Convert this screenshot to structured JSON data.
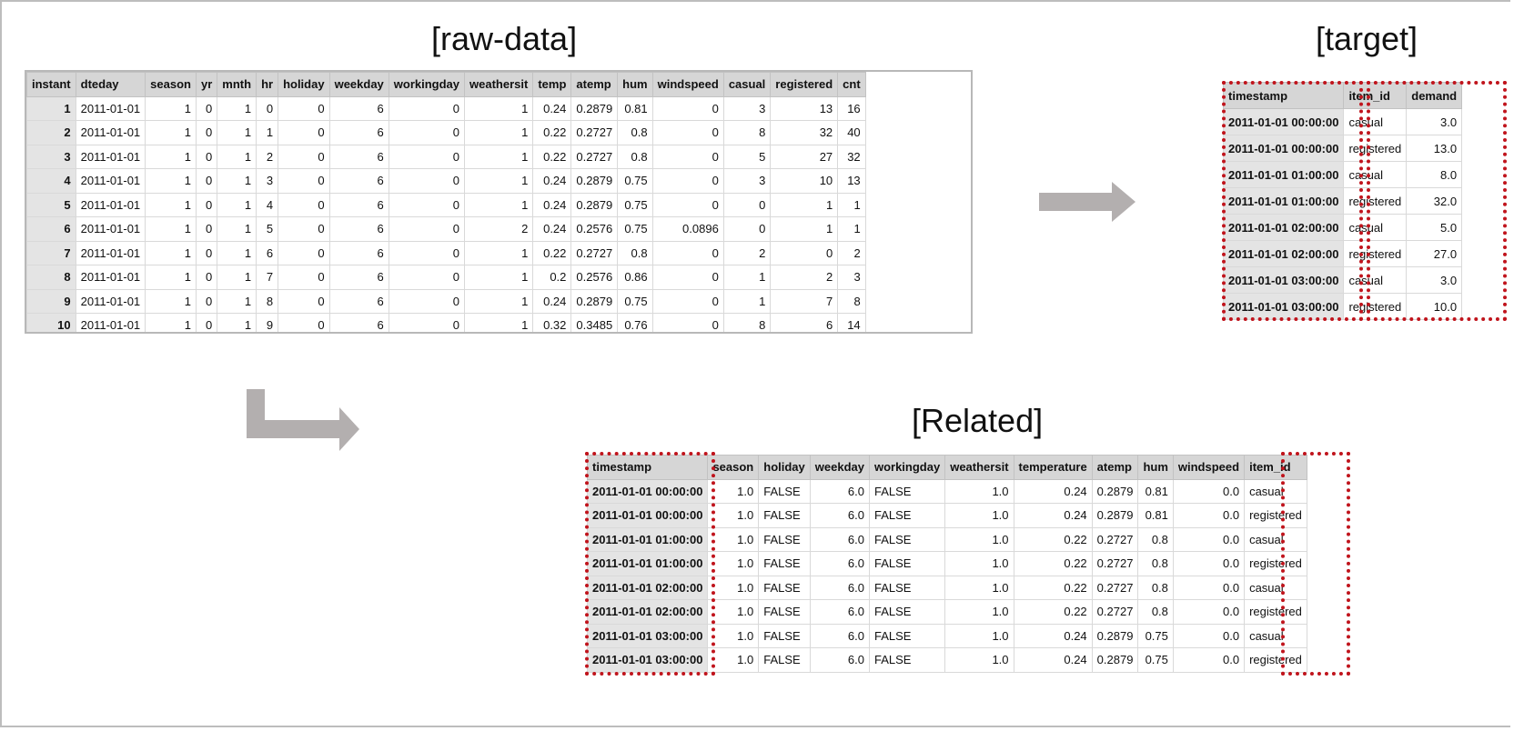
{
  "titles": {
    "raw": "[raw-data]",
    "target": "[target]",
    "related": "[Related]"
  },
  "raw_data": {
    "columns": [
      "instant",
      "dteday",
      "season",
      "yr",
      "mnth",
      "hr",
      "holiday",
      "weekday",
      "workingday",
      "weathersit",
      "temp",
      "atemp",
      "hum",
      "windspeed",
      "casual",
      "registered",
      "cnt"
    ],
    "rows": [
      [
        "1",
        "2011-01-01",
        "1",
        "0",
        "1",
        "0",
        "0",
        "6",
        "0",
        "1",
        "0.24",
        "0.2879",
        "0.81",
        "0",
        "3",
        "13",
        "16"
      ],
      [
        "2",
        "2011-01-01",
        "1",
        "0",
        "1",
        "1",
        "0",
        "6",
        "0",
        "1",
        "0.22",
        "0.2727",
        "0.8",
        "0",
        "8",
        "32",
        "40"
      ],
      [
        "3",
        "2011-01-01",
        "1",
        "0",
        "1",
        "2",
        "0",
        "6",
        "0",
        "1",
        "0.22",
        "0.2727",
        "0.8",
        "0",
        "5",
        "27",
        "32"
      ],
      [
        "4",
        "2011-01-01",
        "1",
        "0",
        "1",
        "3",
        "0",
        "6",
        "0",
        "1",
        "0.24",
        "0.2879",
        "0.75",
        "0",
        "3",
        "10",
        "13"
      ],
      [
        "5",
        "2011-01-01",
        "1",
        "0",
        "1",
        "4",
        "0",
        "6",
        "0",
        "1",
        "0.24",
        "0.2879",
        "0.75",
        "0",
        "0",
        "1",
        "1"
      ],
      [
        "6",
        "2011-01-01",
        "1",
        "0",
        "1",
        "5",
        "0",
        "6",
        "0",
        "2",
        "0.24",
        "0.2576",
        "0.75",
        "0.0896",
        "0",
        "1",
        "1"
      ],
      [
        "7",
        "2011-01-01",
        "1",
        "0",
        "1",
        "6",
        "0",
        "6",
        "0",
        "1",
        "0.22",
        "0.2727",
        "0.8",
        "0",
        "2",
        "0",
        "2"
      ],
      [
        "8",
        "2011-01-01",
        "1",
        "0",
        "1",
        "7",
        "0",
        "6",
        "0",
        "1",
        "0.2",
        "0.2576",
        "0.86",
        "0",
        "1",
        "2",
        "3"
      ],
      [
        "9",
        "2011-01-01",
        "1",
        "0",
        "1",
        "8",
        "0",
        "6",
        "0",
        "1",
        "0.24",
        "0.2879",
        "0.75",
        "0",
        "1",
        "7",
        "8"
      ],
      [
        "10",
        "2011-01-01",
        "1",
        "0",
        "1",
        "9",
        "0",
        "6",
        "0",
        "1",
        "0.32",
        "0.3485",
        "0.76",
        "0",
        "8",
        "6",
        "14"
      ]
    ]
  },
  "target": {
    "columns": [
      "timestamp",
      "item_id",
      "demand"
    ],
    "rows": [
      [
        "2011-01-01 00:00:00",
        "casual",
        "3.0"
      ],
      [
        "2011-01-01 00:00:00",
        "registered",
        "13.0"
      ],
      [
        "2011-01-01 01:00:00",
        "casual",
        "8.0"
      ],
      [
        "2011-01-01 01:00:00",
        "registered",
        "32.0"
      ],
      [
        "2011-01-01 02:00:00",
        "casual",
        "5.0"
      ],
      [
        "2011-01-01 02:00:00",
        "registered",
        "27.0"
      ],
      [
        "2011-01-01 03:00:00",
        "casual",
        "3.0"
      ],
      [
        "2011-01-01 03:00:00",
        "registered",
        "10.0"
      ]
    ]
  },
  "related": {
    "columns": [
      "timestamp",
      "season",
      "holiday",
      "weekday",
      "workingday",
      "weathersit",
      "temperature",
      "atemp",
      "hum",
      "windspeed",
      "item_id"
    ],
    "rows": [
      [
        "2011-01-01 00:00:00",
        "1.0",
        "FALSE",
        "6.0",
        "FALSE",
        "1.0",
        "0.24",
        "0.2879",
        "0.81",
        "0.0",
        "casual"
      ],
      [
        "2011-01-01 00:00:00",
        "1.0",
        "FALSE",
        "6.0",
        "FALSE",
        "1.0",
        "0.24",
        "0.2879",
        "0.81",
        "0.0",
        "registered"
      ],
      [
        "2011-01-01 01:00:00",
        "1.0",
        "FALSE",
        "6.0",
        "FALSE",
        "1.0",
        "0.22",
        "0.2727",
        "0.8",
        "0.0",
        "casual"
      ],
      [
        "2011-01-01 01:00:00",
        "1.0",
        "FALSE",
        "6.0",
        "FALSE",
        "1.0",
        "0.22",
        "0.2727",
        "0.8",
        "0.0",
        "registered"
      ],
      [
        "2011-01-01 02:00:00",
        "1.0",
        "FALSE",
        "6.0",
        "FALSE",
        "1.0",
        "0.22",
        "0.2727",
        "0.8",
        "0.0",
        "casual"
      ],
      [
        "2011-01-01 02:00:00",
        "1.0",
        "FALSE",
        "6.0",
        "FALSE",
        "1.0",
        "0.22",
        "0.2727",
        "0.8",
        "0.0",
        "registered"
      ],
      [
        "2011-01-01 03:00:00",
        "1.0",
        "FALSE",
        "6.0",
        "FALSE",
        "1.0",
        "0.24",
        "0.2879",
        "0.75",
        "0.0",
        "casual"
      ],
      [
        "2011-01-01 03:00:00",
        "1.0",
        "FALSE",
        "6.0",
        "FALSE",
        "1.0",
        "0.24",
        "0.2879",
        "0.75",
        "0.0",
        "registered"
      ]
    ]
  },
  "colors": {
    "highlight": "#c0141c",
    "arrow": "#b3afaf",
    "header_bg": "#d6d6d6"
  }
}
